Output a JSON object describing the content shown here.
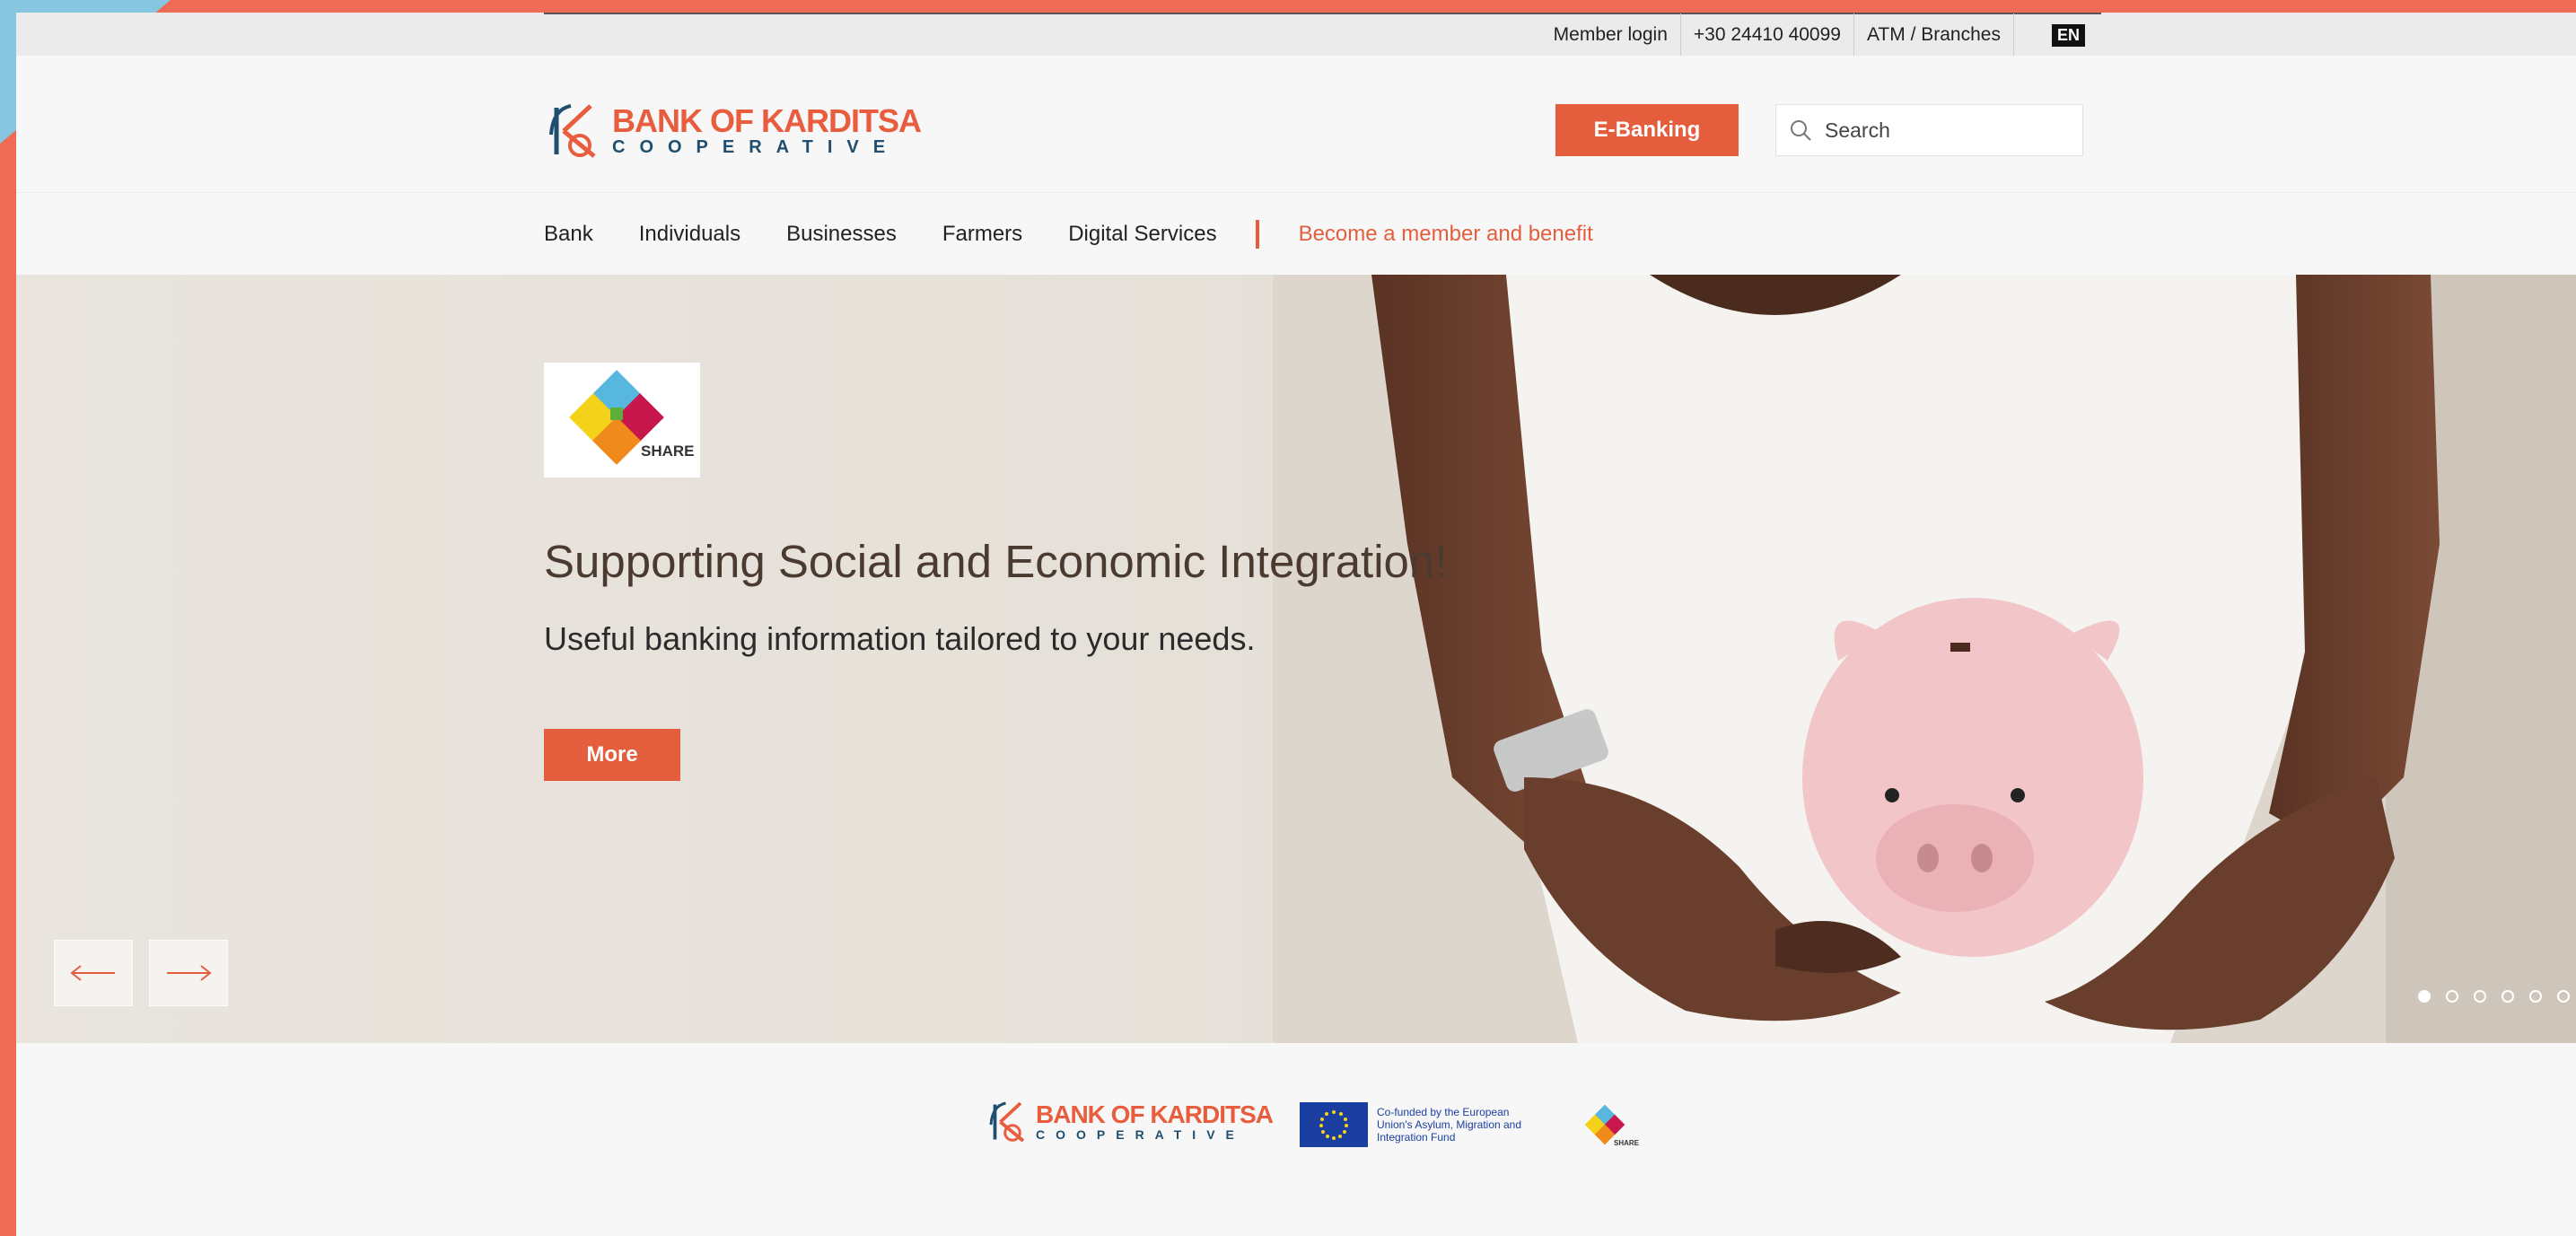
{
  "topbar": {
    "member_login": "Member login",
    "phone": "+30 24410 40099",
    "atm": "ATM / Branches",
    "lang": "EN"
  },
  "header": {
    "logo_title": "BANK OF KARDITSA",
    "logo_subtitle": "COOPERATIVE",
    "ebanking_label": "E-Banking",
    "search_placeholder": "Search"
  },
  "nav": {
    "items": [
      "Bank",
      "Individuals",
      "Businesses",
      "Farmers",
      "Digital Services"
    ],
    "cta": "Become a member and benefit"
  },
  "hero": {
    "badge_text": "SHARE",
    "title": "Supporting Social and Economic Integration!",
    "subtitle": "Useful banking information tailored to your needs.",
    "more_label": "More",
    "slides_total": 6,
    "active_slide": 1
  },
  "footer": {
    "bank_logo_title": "BANK OF KARDITSA",
    "bank_logo_subtitle": "COOPERATIVE",
    "eu_text": "Co-funded by the European Union's Asylum, Migration and Integration Fund",
    "share_text": "SHARE"
  },
  "colors": {
    "accent": "#e45e3e",
    "navy": "#1f4e6e",
    "eu_blue": "#1b3fa0"
  }
}
